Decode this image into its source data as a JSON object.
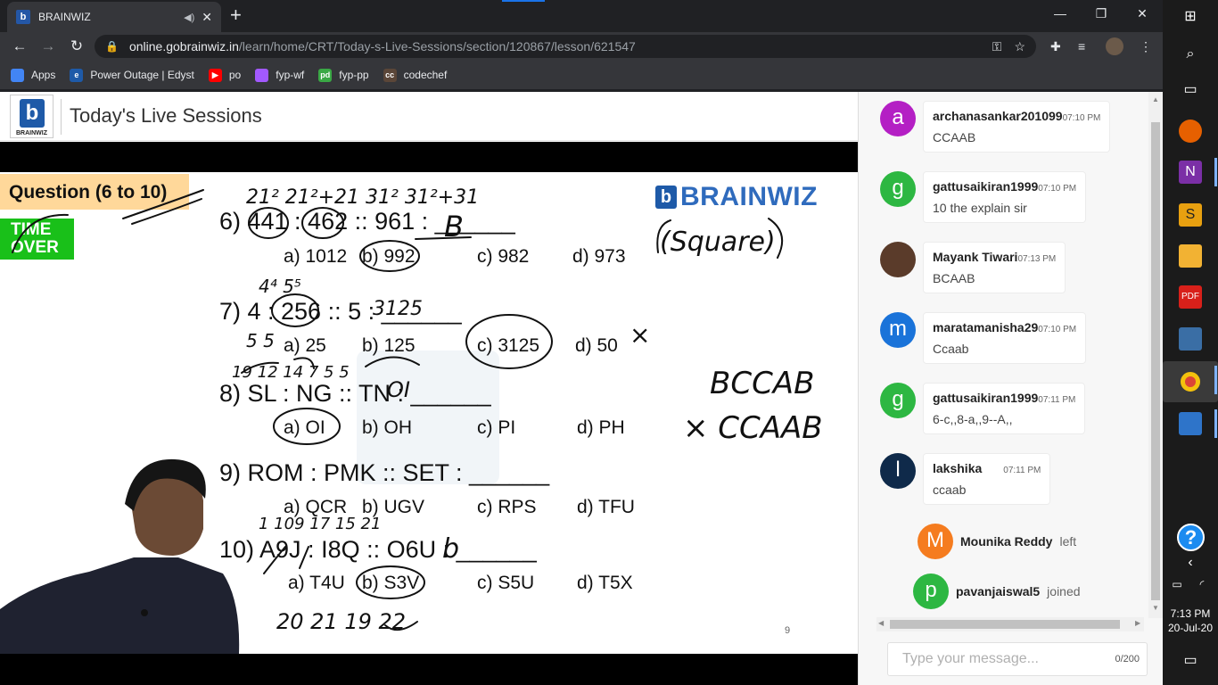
{
  "browser": {
    "tab_title": "BRAINWIZ",
    "url_host": "online.gobrainwiz.in",
    "url_path": "/learn/home/CRT/Today-s-Live-Sessions/section/120867/lesson/621547",
    "bookmarks": [
      {
        "label": "Apps",
        "color": "#4285f4"
      },
      {
        "label": "Power Outage | Edyst",
        "color": "#1e5aa8"
      },
      {
        "label": "po",
        "color": "#ff0000"
      },
      {
        "label": "fyp-wf",
        "color": "#a259ff"
      },
      {
        "label": "fyp-pp",
        "color": "#3aa845"
      },
      {
        "label": "codechef",
        "color": "#5b4638"
      }
    ]
  },
  "header": {
    "logo_text": "BRAINWIZ",
    "title": "Today's Live Sessions"
  },
  "slide": {
    "badge": "Question (6 to 10)",
    "time_over_1": "TIME",
    "time_over_2": "OVER",
    "brand": "BRAINWIZ",
    "brand_mark": "b",
    "page_number": "9",
    "questions": [
      {
        "text": "6) 441 : 462 :: 961 : ______",
        "options": [
          "a) 1012",
          "b) 992",
          "c) 982",
          "d) 973"
        ]
      },
      {
        "text": "7) 4 : 256 :: 5 : ______",
        "options": [
          "a) 25",
          "b) 125",
          "c) 3125",
          "d) 50"
        ]
      },
      {
        "text": "8) SL : NG :: TN : ______",
        "options": [
          "a) OI",
          "b) OH",
          "c) PI",
          "d) PH"
        ]
      },
      {
        "text": "9) ROM : PMK :: SET : ______",
        "options": [
          "a) QCR",
          "b) UGV",
          "c) RPS",
          "d) TFU"
        ]
      },
      {
        "text": "10) A9J : I8Q :: O6U : ______",
        "options": [
          "a) T4U",
          "b) S3V",
          "c) S5U",
          "d) T5X"
        ]
      }
    ],
    "handwriting": {
      "q6_top": "21²     21²+21   31²     31²+31",
      "q6_answer": "B",
      "square": "(Square)",
      "q7_top": "4⁴              5⁵",
      "q7_answer": "3125",
      "q7_marks": "5  5",
      "q7_cross": "×",
      "q8_top": "19 12  14 7      5  5",
      "q8_answer": "OI",
      "side_1": "BCCAB",
      "side_2": "× CCAAB",
      "q10_top": "1   109   17   15   21",
      "q10_answer": "b",
      "q10_bottom": "20    21     19  22"
    }
  },
  "chat": {
    "messages": [
      {
        "initial": "a",
        "name": "archanasankar201099",
        "time": "07:10 PM",
        "text": "CCAAB",
        "color": "#b41fc4"
      },
      {
        "initial": "g",
        "name": "gattusaikiran1999",
        "time": "07:10 PM",
        "text": "10 the explain sir",
        "color": "#2db742"
      },
      {
        "initial": "",
        "name": "Mayank Tiwari",
        "time": "07:13 PM",
        "text": "BCAAB",
        "color": "#5a3b2a"
      },
      {
        "initial": "m",
        "name": "maratamanisha29",
        "time": "07:10 PM",
        "text": "Ccaab",
        "color": "#1a73d9"
      },
      {
        "initial": "g",
        "name": "gattusaikiran1999",
        "time": "07:11 PM",
        "text": "6-c,,8-a,,9--A,,",
        "color": "#2db742"
      },
      {
        "initial": "l",
        "name": "lakshika",
        "time": "07:11 PM",
        "text": "ccaab",
        "color": "#0f2a4a"
      }
    ],
    "events": [
      {
        "initial": "M",
        "name": "Mounika Reddy",
        "action": "left",
        "color": "#f57c1f"
      },
      {
        "initial": "p",
        "name": "pavanjaiswal5",
        "action": "joined",
        "color": "#2db742"
      }
    ],
    "input_placeholder": "Type your message...",
    "char_count": "0/200"
  },
  "taskbar": {
    "time": "7:13 PM",
    "date": "20-Jul-20",
    "help": "?"
  }
}
